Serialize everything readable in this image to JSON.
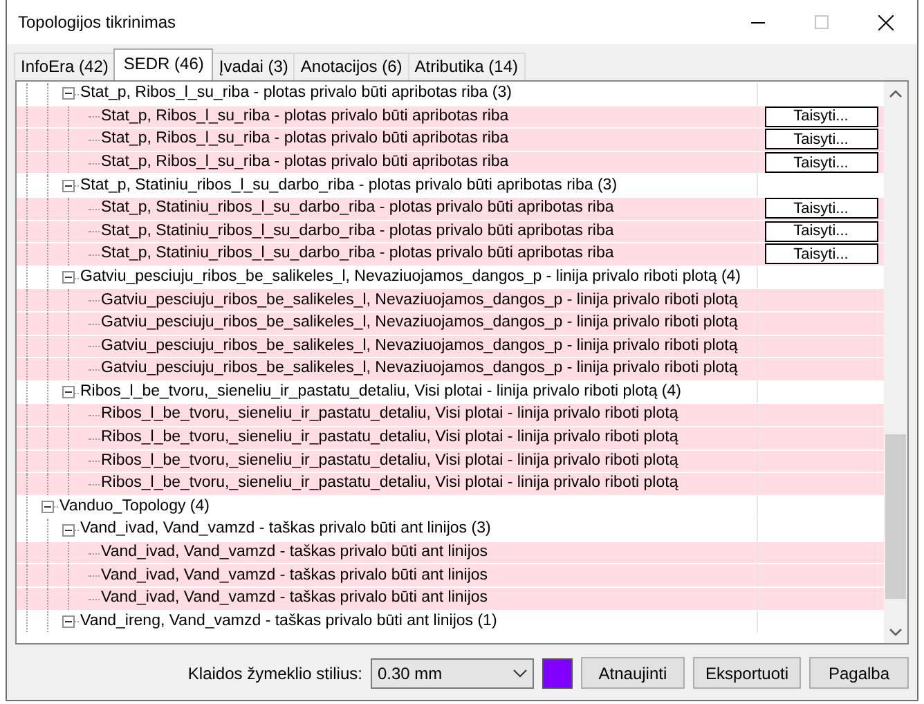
{
  "window": {
    "title": "Topologijos tikrinimas",
    "maximize_disabled": true
  },
  "tabs": [
    {
      "label": "InfoEra (42)",
      "selected": false
    },
    {
      "label": "SEDR (46)",
      "selected": true
    },
    {
      "label": "Įvadai (3)",
      "selected": false
    },
    {
      "label": "Anotacijos (6)",
      "selected": false
    },
    {
      "label": "Atributika (14)",
      "selected": false
    }
  ],
  "tree": [
    {
      "children": [
        {
          "label": "Stat_p, Ribos_l_su_riba - plotas privalo būti apribotas riba (3)",
          "expanded": true,
          "highlighted": false,
          "children": [
            {
              "label": "Stat_p, Ribos_l_su_riba - plotas privalo būti apribotas riba",
              "highlighted": true,
              "action": "Taisyti..."
            },
            {
              "label": "Stat_p, Ribos_l_su_riba - plotas privalo būti apribotas riba",
              "highlighted": true,
              "action": "Taisyti..."
            },
            {
              "label": "Stat_p, Ribos_l_su_riba - plotas privalo būti apribotas riba",
              "highlighted": true,
              "action": "Taisyti..."
            }
          ]
        },
        {
          "label": "Stat_p, Statiniu_ribos_l_su_darbo_riba - plotas privalo būti apribotas riba (3)",
          "expanded": true,
          "highlighted": false,
          "children": [
            {
              "label": "Stat_p, Statiniu_ribos_l_su_darbo_riba - plotas privalo būti apribotas riba",
              "highlighted": true,
              "action": "Taisyti..."
            },
            {
              "label": "Stat_p, Statiniu_ribos_l_su_darbo_riba - plotas privalo būti apribotas riba",
              "highlighted": true,
              "action": "Taisyti..."
            },
            {
              "label": "Stat_p, Statiniu_ribos_l_su_darbo_riba - plotas privalo būti apribotas riba",
              "highlighted": true,
              "action": "Taisyti..."
            }
          ]
        },
        {
          "label": "Gatviu_pesciuju_ribos_be_salikeles_l, Nevaziuojamos_dangos_p - linija privalo riboti plotą (4)",
          "expanded": true,
          "highlighted": false,
          "children": [
            {
              "label": "Gatviu_pesciuju_ribos_be_salikeles_l, Nevaziuojamos_dangos_p - linija privalo riboti plotą",
              "highlighted": true
            },
            {
              "label": "Gatviu_pesciuju_ribos_be_salikeles_l, Nevaziuojamos_dangos_p - linija privalo riboti plotą",
              "highlighted": true
            },
            {
              "label": "Gatviu_pesciuju_ribos_be_salikeles_l, Nevaziuojamos_dangos_p - linija privalo riboti plotą",
              "highlighted": true
            },
            {
              "label": "Gatviu_pesciuju_ribos_be_salikeles_l, Nevaziuojamos_dangos_p - linija privalo riboti plotą",
              "highlighted": true
            }
          ]
        },
        {
          "label": "Ribos_l_be_tvoru,_sieneliu_ir_pastatu_detaliu, Visi plotai - linija privalo riboti plotą (4)",
          "expanded": true,
          "highlighted": false,
          "children": [
            {
              "label": "Ribos_l_be_tvoru,_sieneliu_ir_pastatu_detaliu, Visi plotai - linija privalo riboti plotą",
              "highlighted": true
            },
            {
              "label": "Ribos_l_be_tvoru,_sieneliu_ir_pastatu_detaliu, Visi plotai - linija privalo riboti plotą",
              "highlighted": true
            },
            {
              "label": "Ribos_l_be_tvoru,_sieneliu_ir_pastatu_detaliu, Visi plotai - linija privalo riboti plotą",
              "highlighted": true
            },
            {
              "label": "Ribos_l_be_tvoru,_sieneliu_ir_pastatu_detaliu, Visi plotai - linija privalo riboti plotą",
              "highlighted": true
            }
          ]
        }
      ]
    },
    {
      "label": "Vanduo_Topology (4)",
      "expanded": true,
      "highlighted": false,
      "children": [
        {
          "label": "Vand_ivad, Vand_vamzd - taškas privalo būti ant linijos (3)",
          "expanded": true,
          "highlighted": false,
          "children": [
            {
              "label": "Vand_ivad, Vand_vamzd - taškas privalo būti ant linijos",
              "highlighted": true
            },
            {
              "label": "Vand_ivad, Vand_vamzd - taškas privalo būti ant linijos",
              "highlighted": true
            },
            {
              "label": "Vand_ivad, Vand_vamzd - taškas privalo būti ant linijos",
              "highlighted": true
            }
          ]
        },
        {
          "label": "Vand_ireng, Vand_vamzd - taškas privalo būti ant linijos (1)",
          "expanded": true,
          "highlighted": false
        }
      ]
    }
  ],
  "footer": {
    "label": "Klaidos žymeklio stilius:",
    "select_value": "0.30 mm",
    "color": "#8000ff",
    "buttons": [
      "Atnaujinti",
      "Eksportuoti",
      "Pagalba"
    ]
  }
}
